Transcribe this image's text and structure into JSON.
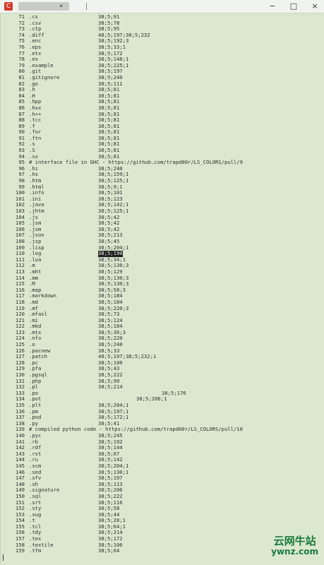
{
  "window": {
    "icon_label": "C",
    "tab_title": "...",
    "tab_close": "×",
    "minimize": "−",
    "maximize": "□",
    "close": "×"
  },
  "colors": {
    "background": "#dbe8cf",
    "text": "#2e2e2e",
    "highlight_bg": "#1d1d1d",
    "watermark": "#1a7a3c"
  },
  "watermark": {
    "name": "云网牛站",
    "url": "ywnz.com"
  },
  "lines": [
    {
      "n": "71",
      "ext": ".cs",
      "code": "38;5;91"
    },
    {
      "n": "72",
      "ext": ".csv",
      "code": "38;5;78"
    },
    {
      "n": "73",
      "ext": ".ctp",
      "code": "38;5;95"
    },
    {
      "n": "74",
      "ext": ".diff",
      "code": "48;5;197;38;5;232"
    },
    {
      "n": "75",
      "ext": ".enc",
      "code": "38;5;192;3"
    },
    {
      "n": "76",
      "ext": ".eps",
      "code": "38;5;33;1"
    },
    {
      "n": "77",
      "ext": ".etx",
      "code": "38;5;172"
    },
    {
      "n": "78",
      "ext": ".ex",
      "code": "38;5;148;1"
    },
    {
      "n": "79",
      "ext": ".example",
      "code": "38;5;225;1"
    },
    {
      "n": "80",
      "ext": ".git",
      "code": "38;5;197"
    },
    {
      "n": "81",
      "ext": ".gitignore",
      "code": "38;5;240"
    },
    {
      "n": "82",
      "ext": ".go",
      "code": "38;5;111"
    },
    {
      "n": "83",
      "ext": ".h",
      "code": "38;5;81"
    },
    {
      "n": "84",
      "ext": ".H",
      "code": "38;5;81"
    },
    {
      "n": "85",
      "ext": ".hpp",
      "code": "38;5;81"
    },
    {
      "n": "86",
      "ext": ".hxx",
      "code": "38;5;81"
    },
    {
      "n": "87",
      "ext": ".h++",
      "code": "38;5;81"
    },
    {
      "n": "88",
      "ext": ".tcc",
      "code": "38;5;81"
    },
    {
      "n": "89",
      "ext": ".f",
      "code": "38;5;81"
    },
    {
      "n": "90",
      "ext": ".for",
      "code": "38;5;81"
    },
    {
      "n": "91",
      "ext": ".ftn",
      "code": "38;5;81"
    },
    {
      "n": "92",
      "ext": ".s",
      "code": "38;5;81"
    },
    {
      "n": "93",
      "ext": ".S",
      "code": "38;5;81"
    },
    {
      "n": "94",
      "ext": ".sx",
      "code": "38;5;81"
    },
    {
      "n": "95",
      "comment": "# interface file in GHC - https://github.com/trapd00r/LS_COLORS/pull/9"
    },
    {
      "n": "96",
      "ext": ".hi",
      "code": "38;5;240"
    },
    {
      "n": "97",
      "ext": ".hs",
      "code": "38;5;159;1"
    },
    {
      "n": "98",
      "ext": ".htm",
      "code": "38;5;125;1"
    },
    {
      "n": "99",
      "ext": ".html",
      "code": "38;5;9;1"
    },
    {
      "n": "100",
      "ext": ".info",
      "code": "38;5;101"
    },
    {
      "n": "101",
      "ext": ".ini",
      "code": "38;5;123"
    },
    {
      "n": "102",
      "ext": ".java",
      "code": "38;5;142;1"
    },
    {
      "n": "103",
      "ext": ".jhtm",
      "code": "38;5;125;1"
    },
    {
      "n": "104",
      "ext": ".js",
      "code": "38;5;42"
    },
    {
      "n": "105",
      "ext": ".jsm",
      "code": "38;5;42"
    },
    {
      "n": "106",
      "ext": ".jsm",
      "code": "38;5;42"
    },
    {
      "n": "107",
      "ext": ".json",
      "code": "38;5;213"
    },
    {
      "n": "108",
      "ext": ".jsp",
      "code": "38;5;45"
    },
    {
      "n": "109",
      "ext": ".lisp",
      "code": "38;5;204;1"
    },
    {
      "n": "110",
      "ext": ".log",
      "code": "38;5;190",
      "highlight": true
    },
    {
      "n": "111",
      "ext": ".lua",
      "code": "38;5;34;1"
    },
    {
      "n": "112",
      "ext": ".m",
      "code": "38;5;130;3"
    },
    {
      "n": "113",
      "ext": ".mht",
      "code": "38;5;129"
    },
    {
      "n": "114",
      "ext": ".mm",
      "code": "38;5;130;3"
    },
    {
      "n": "115",
      "ext": ".M",
      "code": "38;5;130;3"
    },
    {
      "n": "116",
      "ext": ".map",
      "code": "38;5;58;3"
    },
    {
      "n": "117",
      "ext": ".markdown",
      "code": "38;5;184"
    },
    {
      "n": "118",
      "ext": ".md",
      "code": "38;5;184"
    },
    {
      "n": "119",
      "ext": ".mf",
      "code": "38;5;220;3"
    },
    {
      "n": "120",
      "ext": ".mfasl",
      "code": "38;5;73"
    },
    {
      "n": "121",
      "ext": ".mi",
      "code": "38;5;124"
    },
    {
      "n": "122",
      "ext": ".mkd",
      "code": "38;5;184"
    },
    {
      "n": "123",
      "ext": ".mtx",
      "code": "38;5;36;3"
    },
    {
      "n": "124",
      "ext": ".nfo",
      "code": "38;5;220"
    },
    {
      "n": "125",
      "ext": ".o",
      "code": "38;5;240"
    },
    {
      "n": "126",
      "ext": ".pacnew",
      "code": "38;5;33"
    },
    {
      "n": "127",
      "ext": ".patch",
      "code": "48;5;197;38;5;232;1"
    },
    {
      "n": "128",
      "ext": ".pc",
      "code": "38;5;100"
    },
    {
      "n": "129",
      "ext": ".pfa",
      "code": "38;5;43"
    },
    {
      "n": "130",
      "ext": ".pgsql",
      "code": "38;5;222"
    },
    {
      "n": "131",
      "ext": ".php",
      "code": "38;5;99"
    },
    {
      "n": "132",
      "ext": ".pl",
      "code": "38;5;214"
    },
    {
      "n": "133",
      "ext": ".po",
      "code": "38;5;176",
      "shift": 2
    },
    {
      "n": "134",
      "ext": ".pot",
      "code": "38;5;206;1",
      "shift": 1
    },
    {
      "n": "135",
      "ext": ".plt",
      "code": "38;5;204;1"
    },
    {
      "n": "136",
      "ext": ".pm",
      "code": "38;5;197;1"
    },
    {
      "n": "137",
      "ext": ".pod",
      "code": "38;5;172;1"
    },
    {
      "n": "138",
      "ext": ".py",
      "code": "38;5;41"
    },
    {
      "n": "139",
      "comment": "# compiled python code - https://github.com/trapd00r/LS_COLORS/pull/10"
    },
    {
      "n": "140",
      "ext": ".pyc",
      "code": "38;5;245"
    },
    {
      "n": "141",
      "ext": ".rb",
      "code": "38;5;192"
    },
    {
      "n": "142",
      "ext": ".rdf",
      "code": "38;5;144"
    },
    {
      "n": "143",
      "ext": ".rst",
      "code": "38;5;67"
    },
    {
      "n": "144",
      "ext": ".ru",
      "code": "38;5;142"
    },
    {
      "n": "145",
      "ext": ".scm",
      "code": "38;5;204;1"
    },
    {
      "n": "146",
      "ext": ".sed",
      "code": "38;5;130;1"
    },
    {
      "n": "147",
      "ext": ".sfv",
      "code": "38;5;197"
    },
    {
      "n": "148",
      "ext": ".sh",
      "code": "38;5;113"
    },
    {
      "n": "149",
      "ext": ".signature",
      "code": "38;5;206"
    },
    {
      "n": "150",
      "ext": ".sql",
      "code": "38;5;222"
    },
    {
      "n": "151",
      "ext": ".srt",
      "code": "38;5;116"
    },
    {
      "n": "152",
      "ext": ".sty",
      "code": "38;5;58"
    },
    {
      "n": "153",
      "ext": ".sug",
      "code": "38;5;44"
    },
    {
      "n": "154",
      "ext": ".t",
      "code": "38;5;28;1"
    },
    {
      "n": "155",
      "ext": ".tcl",
      "code": "38;5;64;1"
    },
    {
      "n": "156",
      "ext": ".tdy",
      "code": "38;5;214"
    },
    {
      "n": "157",
      "ext": ".tex",
      "code": "38;5;172"
    },
    {
      "n": "158",
      "ext": ".textile",
      "code": "38;5;106"
    },
    {
      "n": "159",
      "ext": ".tfm",
      "code": "38;5;64"
    }
  ]
}
